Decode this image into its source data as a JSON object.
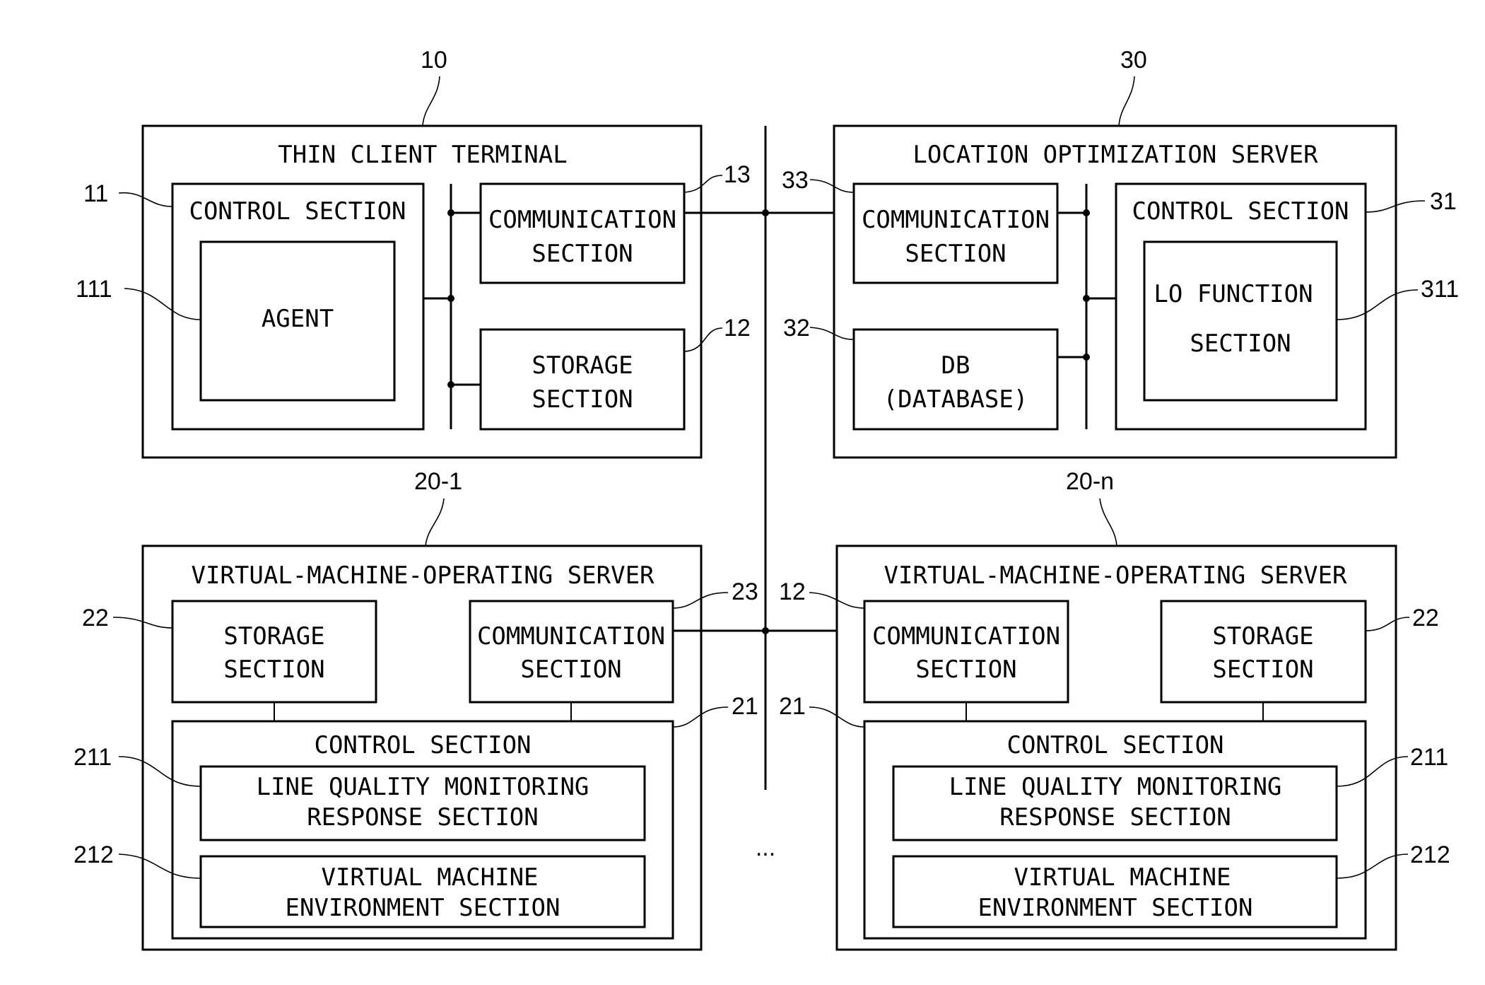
{
  "figure": {
    "thin_client": {
      "ref": "10",
      "title": "THIN CLIENT TERMINAL",
      "control": {
        "ref": "11",
        "label": "CONTROL SECTION"
      },
      "agent": {
        "ref": "111",
        "label": "AGENT"
      },
      "communication": {
        "ref": "13",
        "line1": "COMMUNICATION",
        "line2": "SECTION"
      },
      "storage": {
        "ref": "12",
        "line1": "STORAGE",
        "line2": "SECTION"
      }
    },
    "location_server": {
      "ref": "30",
      "title": "LOCATION OPTIMIZATION SERVER",
      "communication": {
        "ref": "33",
        "line1": "COMMUNICATION",
        "line2": "SECTION"
      },
      "db": {
        "ref": "32",
        "line1": "DB",
        "line2": "(DATABASE)"
      },
      "control": {
        "ref": "31",
        "label": "CONTROL SECTION"
      },
      "lo_function": {
        "ref": "311",
        "line1": "LO FUNCTION",
        "line2": "SECTION"
      }
    },
    "vm_server_1": {
      "ref": "20-1",
      "title": "VIRTUAL-MACHINE-OPERATING SERVER",
      "storage": {
        "ref": "22",
        "line1": "STORAGE",
        "line2": "SECTION"
      },
      "communication": {
        "ref": "23",
        "line1": "COMMUNICATION",
        "line2": "SECTION"
      },
      "control": {
        "ref": "21",
        "label": "CONTROL SECTION"
      },
      "line_quality": {
        "ref": "211",
        "line1": "LINE QUALITY MONITORING",
        "line2": "RESPONSE SECTION"
      },
      "vm_env": {
        "ref": "212",
        "line1": "VIRTUAL MACHINE",
        "line2": "ENVIRONMENT SECTION"
      }
    },
    "vm_server_n": {
      "ref": "20-n",
      "title": "VIRTUAL-MACHINE-OPERATING SERVER",
      "communication": {
        "ref": "12",
        "line1": "COMMUNICATION",
        "line2": "SECTION"
      },
      "storage": {
        "ref": "22",
        "line1": "STORAGE",
        "line2": "SECTION"
      },
      "control": {
        "ref": "21",
        "label": "CONTROL SECTION"
      },
      "line_quality": {
        "ref": "211",
        "line1": "LINE QUALITY MONITORING",
        "line2": "RESPONSE SECTION"
      },
      "vm_env": {
        "ref": "212",
        "line1": "VIRTUAL MACHINE",
        "line2": "ENVIRONMENT SECTION"
      }
    },
    "ellipsis": "..."
  }
}
